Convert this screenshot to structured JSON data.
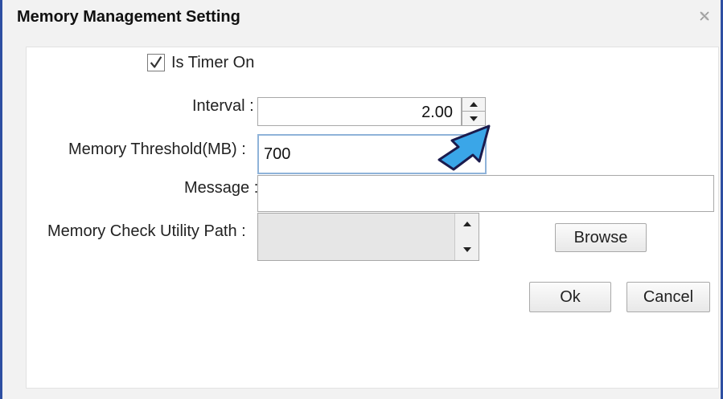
{
  "window": {
    "title": "Memory Management Setting"
  },
  "timer": {
    "label": "Is Timer On",
    "checked": true
  },
  "interval": {
    "label": "Interval :",
    "value": "2.00"
  },
  "threshold": {
    "label": "Memory Threshold(MB)  :",
    "value": "700"
  },
  "message": {
    "label": "Message :",
    "value": ""
  },
  "utility_path": {
    "label": "Memory Check Utility Path  :",
    "value": ""
  },
  "buttons": {
    "browse": "Browse",
    "ok": "Ok",
    "cancel": "Cancel"
  },
  "colors": {
    "window_border": "#2e4fa2",
    "callout_arrow": "#3aa6e8",
    "focus_border": "#8fb3d9"
  },
  "icons": {
    "close": "close-icon",
    "check": "checkmark-icon",
    "spin_up": "triangle-up-icon",
    "spin_down": "triangle-down-icon",
    "annotation": "arrow-callout-icon"
  }
}
